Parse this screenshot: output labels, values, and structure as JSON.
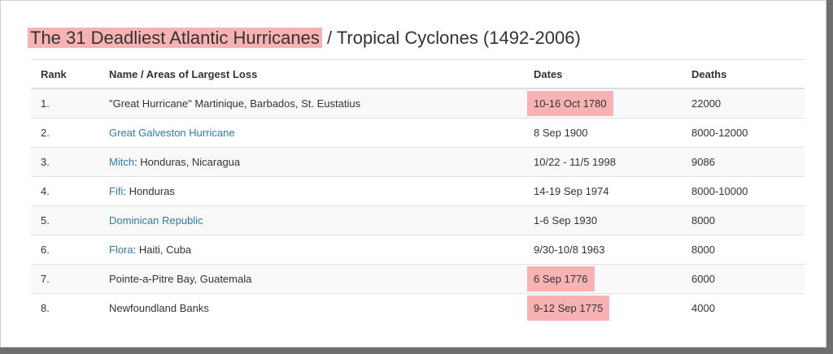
{
  "title": {
    "highlighted": "The 31 Deadliest Atlantic Hurricanes",
    "rest": " / Tropical Cyclones (1492-2006)"
  },
  "colors": {
    "highlight": "#f7b3b3",
    "link": "#2a7ea9",
    "text": "#333333"
  },
  "table": {
    "headers": [
      "Rank",
      "Name / Areas of Largest Loss",
      "Dates",
      "Deaths"
    ],
    "rows": [
      {
        "rank": "1.",
        "link": "",
        "name": "\"Great Hurricane\" Martinique, Barbados, St. Eustatius",
        "dates": "10-16 Oct 1780",
        "deaths": "22000",
        "date_highlighted": true
      },
      {
        "rank": "2.",
        "link": "Great Galveston Hurricane",
        "name": "",
        "dates": "8 Sep 1900",
        "deaths": "8000-12000",
        "date_highlighted": false
      },
      {
        "rank": "3.",
        "link": "Mitch",
        "name": ": Honduras, Nicaragua",
        "dates": "10/22 - 11/5 1998",
        "deaths": "9086",
        "date_highlighted": false
      },
      {
        "rank": "4.",
        "link": "Fifi",
        "name": ": Honduras",
        "dates": "14-19 Sep 1974",
        "deaths": "8000-10000",
        "date_highlighted": false
      },
      {
        "rank": "5.",
        "link": "Dominican Republic",
        "name": "",
        "dates": "1-6 Sep 1930",
        "deaths": "8000",
        "date_highlighted": false
      },
      {
        "rank": "6.",
        "link": "Flora",
        "name": ": Haiti, Cuba",
        "dates": "9/30-10/8 1963",
        "deaths": "8000",
        "date_highlighted": false
      },
      {
        "rank": "7.",
        "link": "",
        "name": "Pointe-a-Pitre Bay, Guatemala",
        "dates": "6 Sep 1776",
        "deaths": "6000",
        "date_highlighted": true
      },
      {
        "rank": "8.",
        "link": "",
        "name": "Newfoundland Banks",
        "dates": "9-12 Sep 1775",
        "deaths": "4000",
        "date_highlighted": true
      }
    ]
  }
}
